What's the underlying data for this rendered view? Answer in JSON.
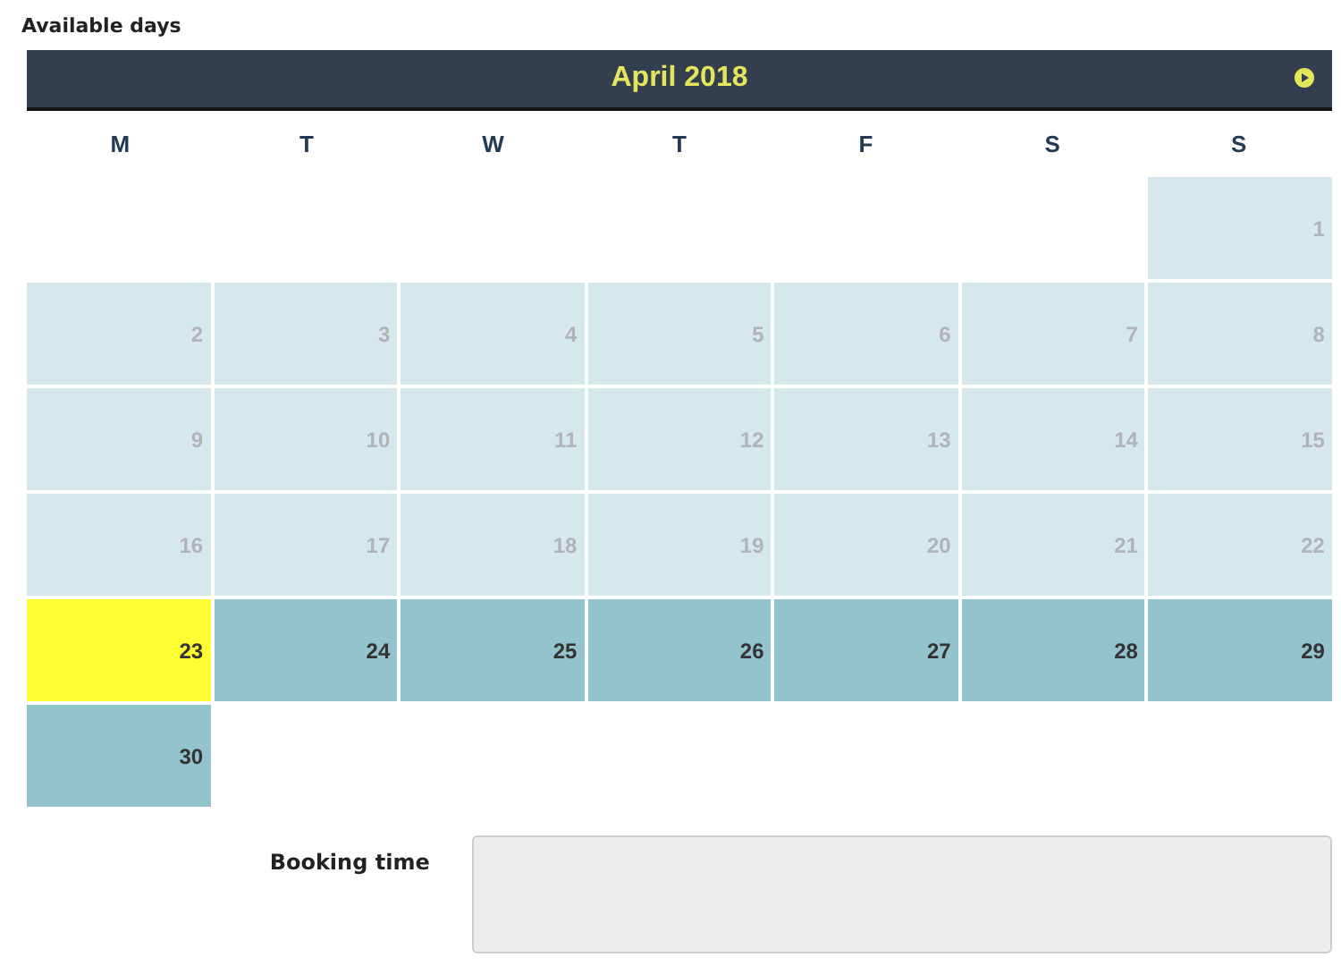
{
  "section_title": "Available days",
  "calendar": {
    "month": "April 2018",
    "weekdays": [
      "M",
      "T",
      "W",
      "T",
      "F",
      "S",
      "S"
    ],
    "days": [
      {
        "label": "1",
        "kind": "past"
      },
      {
        "label": "2",
        "kind": "past"
      },
      {
        "label": "3",
        "kind": "past"
      },
      {
        "label": "4",
        "kind": "past"
      },
      {
        "label": "5",
        "kind": "past"
      },
      {
        "label": "6",
        "kind": "past"
      },
      {
        "label": "7",
        "kind": "past"
      },
      {
        "label": "8",
        "kind": "past"
      },
      {
        "label": "9",
        "kind": "past"
      },
      {
        "label": "10",
        "kind": "past"
      },
      {
        "label": "11",
        "kind": "past"
      },
      {
        "label": "12",
        "kind": "past"
      },
      {
        "label": "13",
        "kind": "past"
      },
      {
        "label": "14",
        "kind": "past"
      },
      {
        "label": "15",
        "kind": "past"
      },
      {
        "label": "16",
        "kind": "past"
      },
      {
        "label": "17",
        "kind": "past"
      },
      {
        "label": "18",
        "kind": "past"
      },
      {
        "label": "19",
        "kind": "past"
      },
      {
        "label": "20",
        "kind": "past"
      },
      {
        "label": "21",
        "kind": "past"
      },
      {
        "label": "22",
        "kind": "past"
      },
      {
        "label": "23",
        "kind": "today"
      },
      {
        "label": "24",
        "kind": "available"
      },
      {
        "label": "25",
        "kind": "available"
      },
      {
        "label": "26",
        "kind": "available"
      },
      {
        "label": "27",
        "kind": "available"
      },
      {
        "label": "28",
        "kind": "available"
      },
      {
        "label": "29",
        "kind": "available"
      },
      {
        "label": "30",
        "kind": "available"
      }
    ]
  },
  "booking_time": {
    "label": "Booking time"
  }
}
